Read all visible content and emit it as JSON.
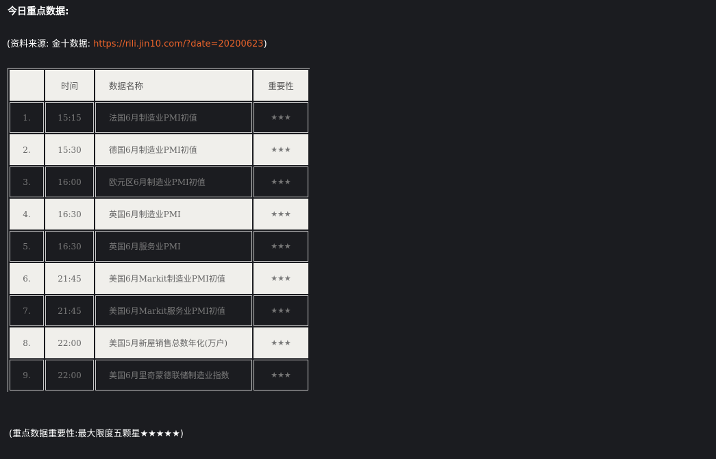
{
  "heading": "今日重点数据:",
  "source": {
    "prefix": "(资料来源: 金十数据: ",
    "link_text": "https://rili.jin10.com/?date=20200623",
    "suffix": ")"
  },
  "table": {
    "headers": [
      "",
      "时间",
      "数据名称",
      "重要性"
    ],
    "rows": [
      {
        "index": "1.",
        "time": "15:15",
        "name": "法国6月制造业PMI初值",
        "importance": "★★★"
      },
      {
        "index": "2.",
        "time": "15:30",
        "name": "德国6月制造业PMI初值",
        "importance": "★★★"
      },
      {
        "index": "3.",
        "time": "16:00",
        "name": "欧元区6月制造业PMI初值",
        "importance": "★★★"
      },
      {
        "index": "4.",
        "time": "16:30",
        "name": "英国6月制造业PMI",
        "importance": "★★★"
      },
      {
        "index": "5.",
        "time": "16:30",
        "name": "英国6月服务业PMI",
        "importance": "★★★"
      },
      {
        "index": "6.",
        "time": "21:45",
        "name": "美国6月Markit制造业PMI初值",
        "importance": "★★★"
      },
      {
        "index": "7.",
        "time": "21:45",
        "name": "美国6月Markit服务业PMI初值",
        "importance": "★★★"
      },
      {
        "index": "8.",
        "time": "22:00",
        "name": "美国5月新屋销售总数年化(万户)",
        "importance": "★★★"
      },
      {
        "index": "9.",
        "time": "22:00",
        "name": "美国6月里奇蒙德联储制造业指数",
        "importance": "★★★"
      }
    ]
  },
  "footer": "(重点数据重要性:最大限度五颗星★★★★★)"
}
